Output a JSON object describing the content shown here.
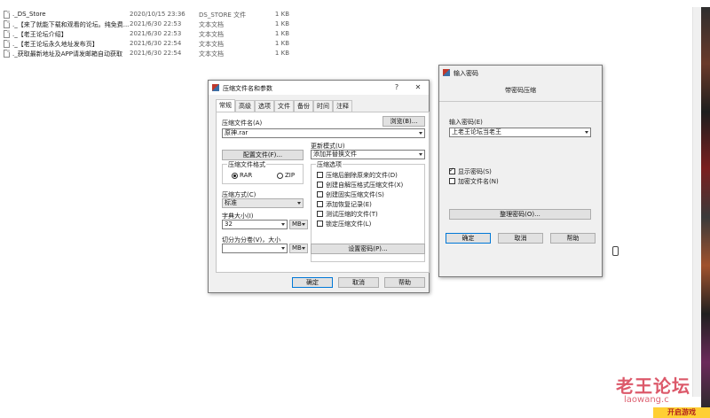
{
  "explorer": {
    "files": [
      {
        "name": "._DS_Store",
        "date": "2020/10/15 23:36",
        "type": "DS_STORE 文件",
        "size": "1 KB"
      },
      {
        "name": "._【来了就能下载和观看的论坛。纯免费...",
        "date": "2021/6/30 22:53",
        "type": "文本文档",
        "size": "1 KB"
      },
      {
        "name": "._【老王论坛介绍】",
        "date": "2021/6/30 22:53",
        "type": "文本文档",
        "size": "1 KB"
      },
      {
        "name": "._【老王论坛永久地址发布页】",
        "date": "2021/6/30 22:54",
        "type": "文本文档",
        "size": "1 KB"
      },
      {
        "name": "._获取最新地址及APP请发邮箱自动获取",
        "date": "2021/6/30 22:54",
        "type": "文本文档",
        "size": "1 KB"
      }
    ],
    "icon": "text-file-icon"
  },
  "archive_dialog": {
    "title": "压缩文件名和参数",
    "help_glyph": "?",
    "close_glyph": "✕",
    "tabs": [
      "常规",
      "高级",
      "选项",
      "文件",
      "备份",
      "时间",
      "注释"
    ],
    "active_tab": "常规",
    "archive_name_label": "压缩文件名(A)",
    "browse_label": "浏览(B)...",
    "archive_name_value": "原神.rar",
    "update_mode_label": "更新模式(U)",
    "update_mode_value": "添加并替换文件",
    "profiles_label": "配置文件(F)...",
    "format_group_label": "压缩文件格式",
    "format_rar": "RAR",
    "format_zip": "ZIP",
    "method_label": "压缩方式(C)",
    "method_value": "标准",
    "dict_label": "字典大小(I)",
    "dict_value": "32",
    "dict_unit": "MB",
    "split_label": "切分为分卷(V)，大小",
    "split_unit": "MB",
    "set_password_label": "设置密码(P)...",
    "options_group_label": "压缩选项",
    "options": [
      {
        "label": "压缩后删除原来的文件(D)",
        "checked": false
      },
      {
        "label": "创建自解压格式压缩文件(X)",
        "checked": false
      },
      {
        "label": "创建固实压缩文件(S)",
        "checked": false
      },
      {
        "label": "添加恢复记录(E)",
        "checked": false
      },
      {
        "label": "测试压缩的文件(T)",
        "checked": false
      },
      {
        "label": "锁定压缩文件(L)",
        "checked": false
      }
    ],
    "ok_label": "确定",
    "cancel_label": "取消",
    "help_label": "帮助"
  },
  "password_dialog": {
    "title": "输入密码",
    "heading": "带密码压缩",
    "password_label": "输入密码(E)",
    "password_value": "上老王论坛当老王",
    "show_password_label": "显示密码(S)",
    "show_password_checked": true,
    "encrypt_names_label": "加密文件名(N)",
    "encrypt_names_checked": false,
    "organize_label": "整理密码(O)...",
    "ok_label": "确定",
    "cancel_label": "取消",
    "help_label": "帮助"
  },
  "watermark": {
    "text": "老王论坛",
    "url": "laowang.c"
  },
  "corner_badge": "开启游戏",
  "colors": {
    "dialog_bg": "#f0f0f0",
    "accent": "#0078d7",
    "watermark": "#d63c50"
  }
}
